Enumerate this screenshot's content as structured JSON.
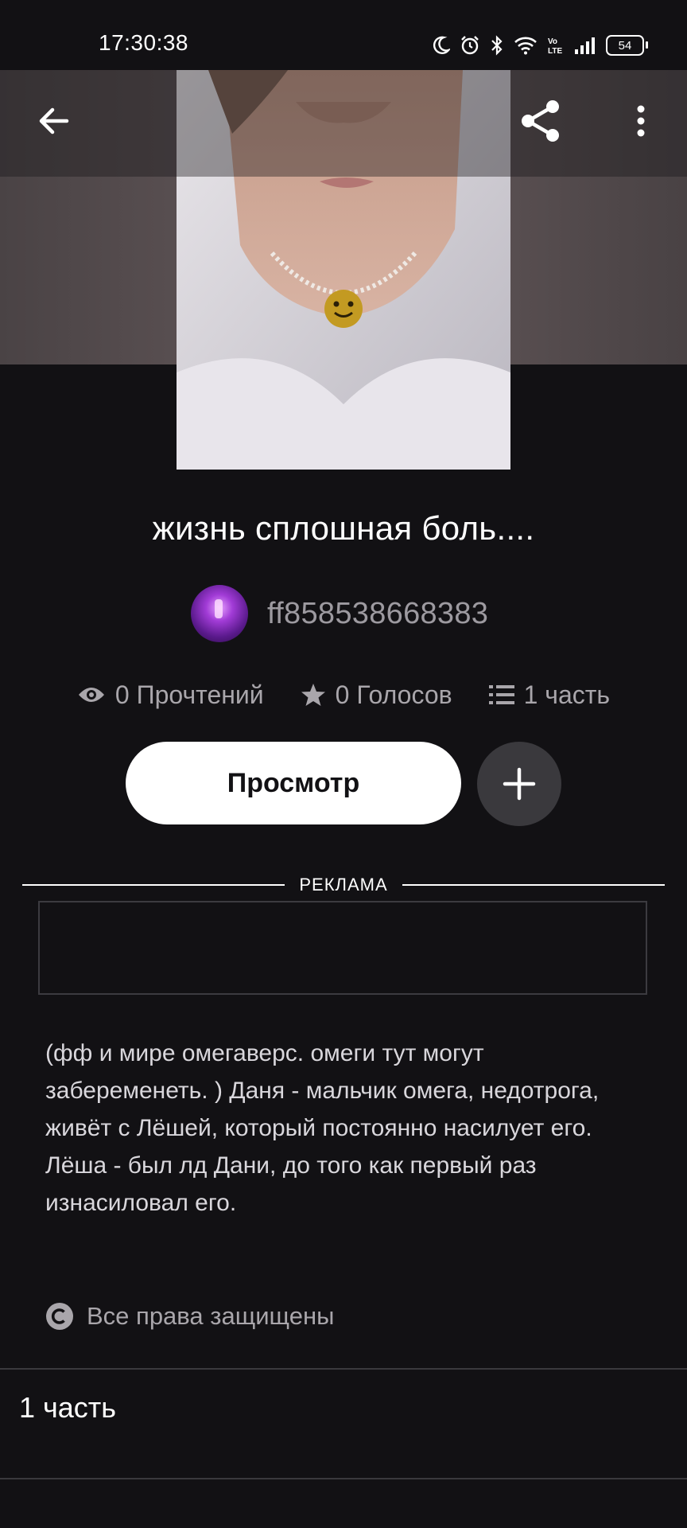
{
  "status_bar": {
    "time": "17:30:38",
    "battery": "54",
    "icons": [
      "moon-icon",
      "alarm-icon",
      "bluetooth-icon",
      "wifi-icon",
      "volte-icon",
      "signal-icon",
      "battery-icon"
    ]
  },
  "app_bar": {
    "back_icon": "arrow-left-icon",
    "share_icon": "share-icon",
    "menu_icon": "more-vertical-icon"
  },
  "story": {
    "title": "жизнь сплошная боль....",
    "author": "ff858538668383",
    "stats": {
      "reads": "0 Прочтений",
      "votes": "0 Голосов",
      "parts": "1 часть"
    },
    "view_button": "Просмотр",
    "description": "(фф и мире омегаверс. омеги тут могут забеременеть. ) Даня - мальчик омега, недотрога, живёт с Лёшей, который постоянно насилует его.\nЛёша - был лд Дани, до того как первый раз изнасиловал его.",
    "copyright": "Все права защищены"
  },
  "ad": {
    "label": "РЕКЛАМА"
  },
  "parts_section": {
    "heading": "1 часть"
  },
  "colors": {
    "background": "#121114",
    "button_primary": "#ffffff",
    "button_secondary": "#3a393d",
    "muted_text": "#a9a6ab"
  }
}
